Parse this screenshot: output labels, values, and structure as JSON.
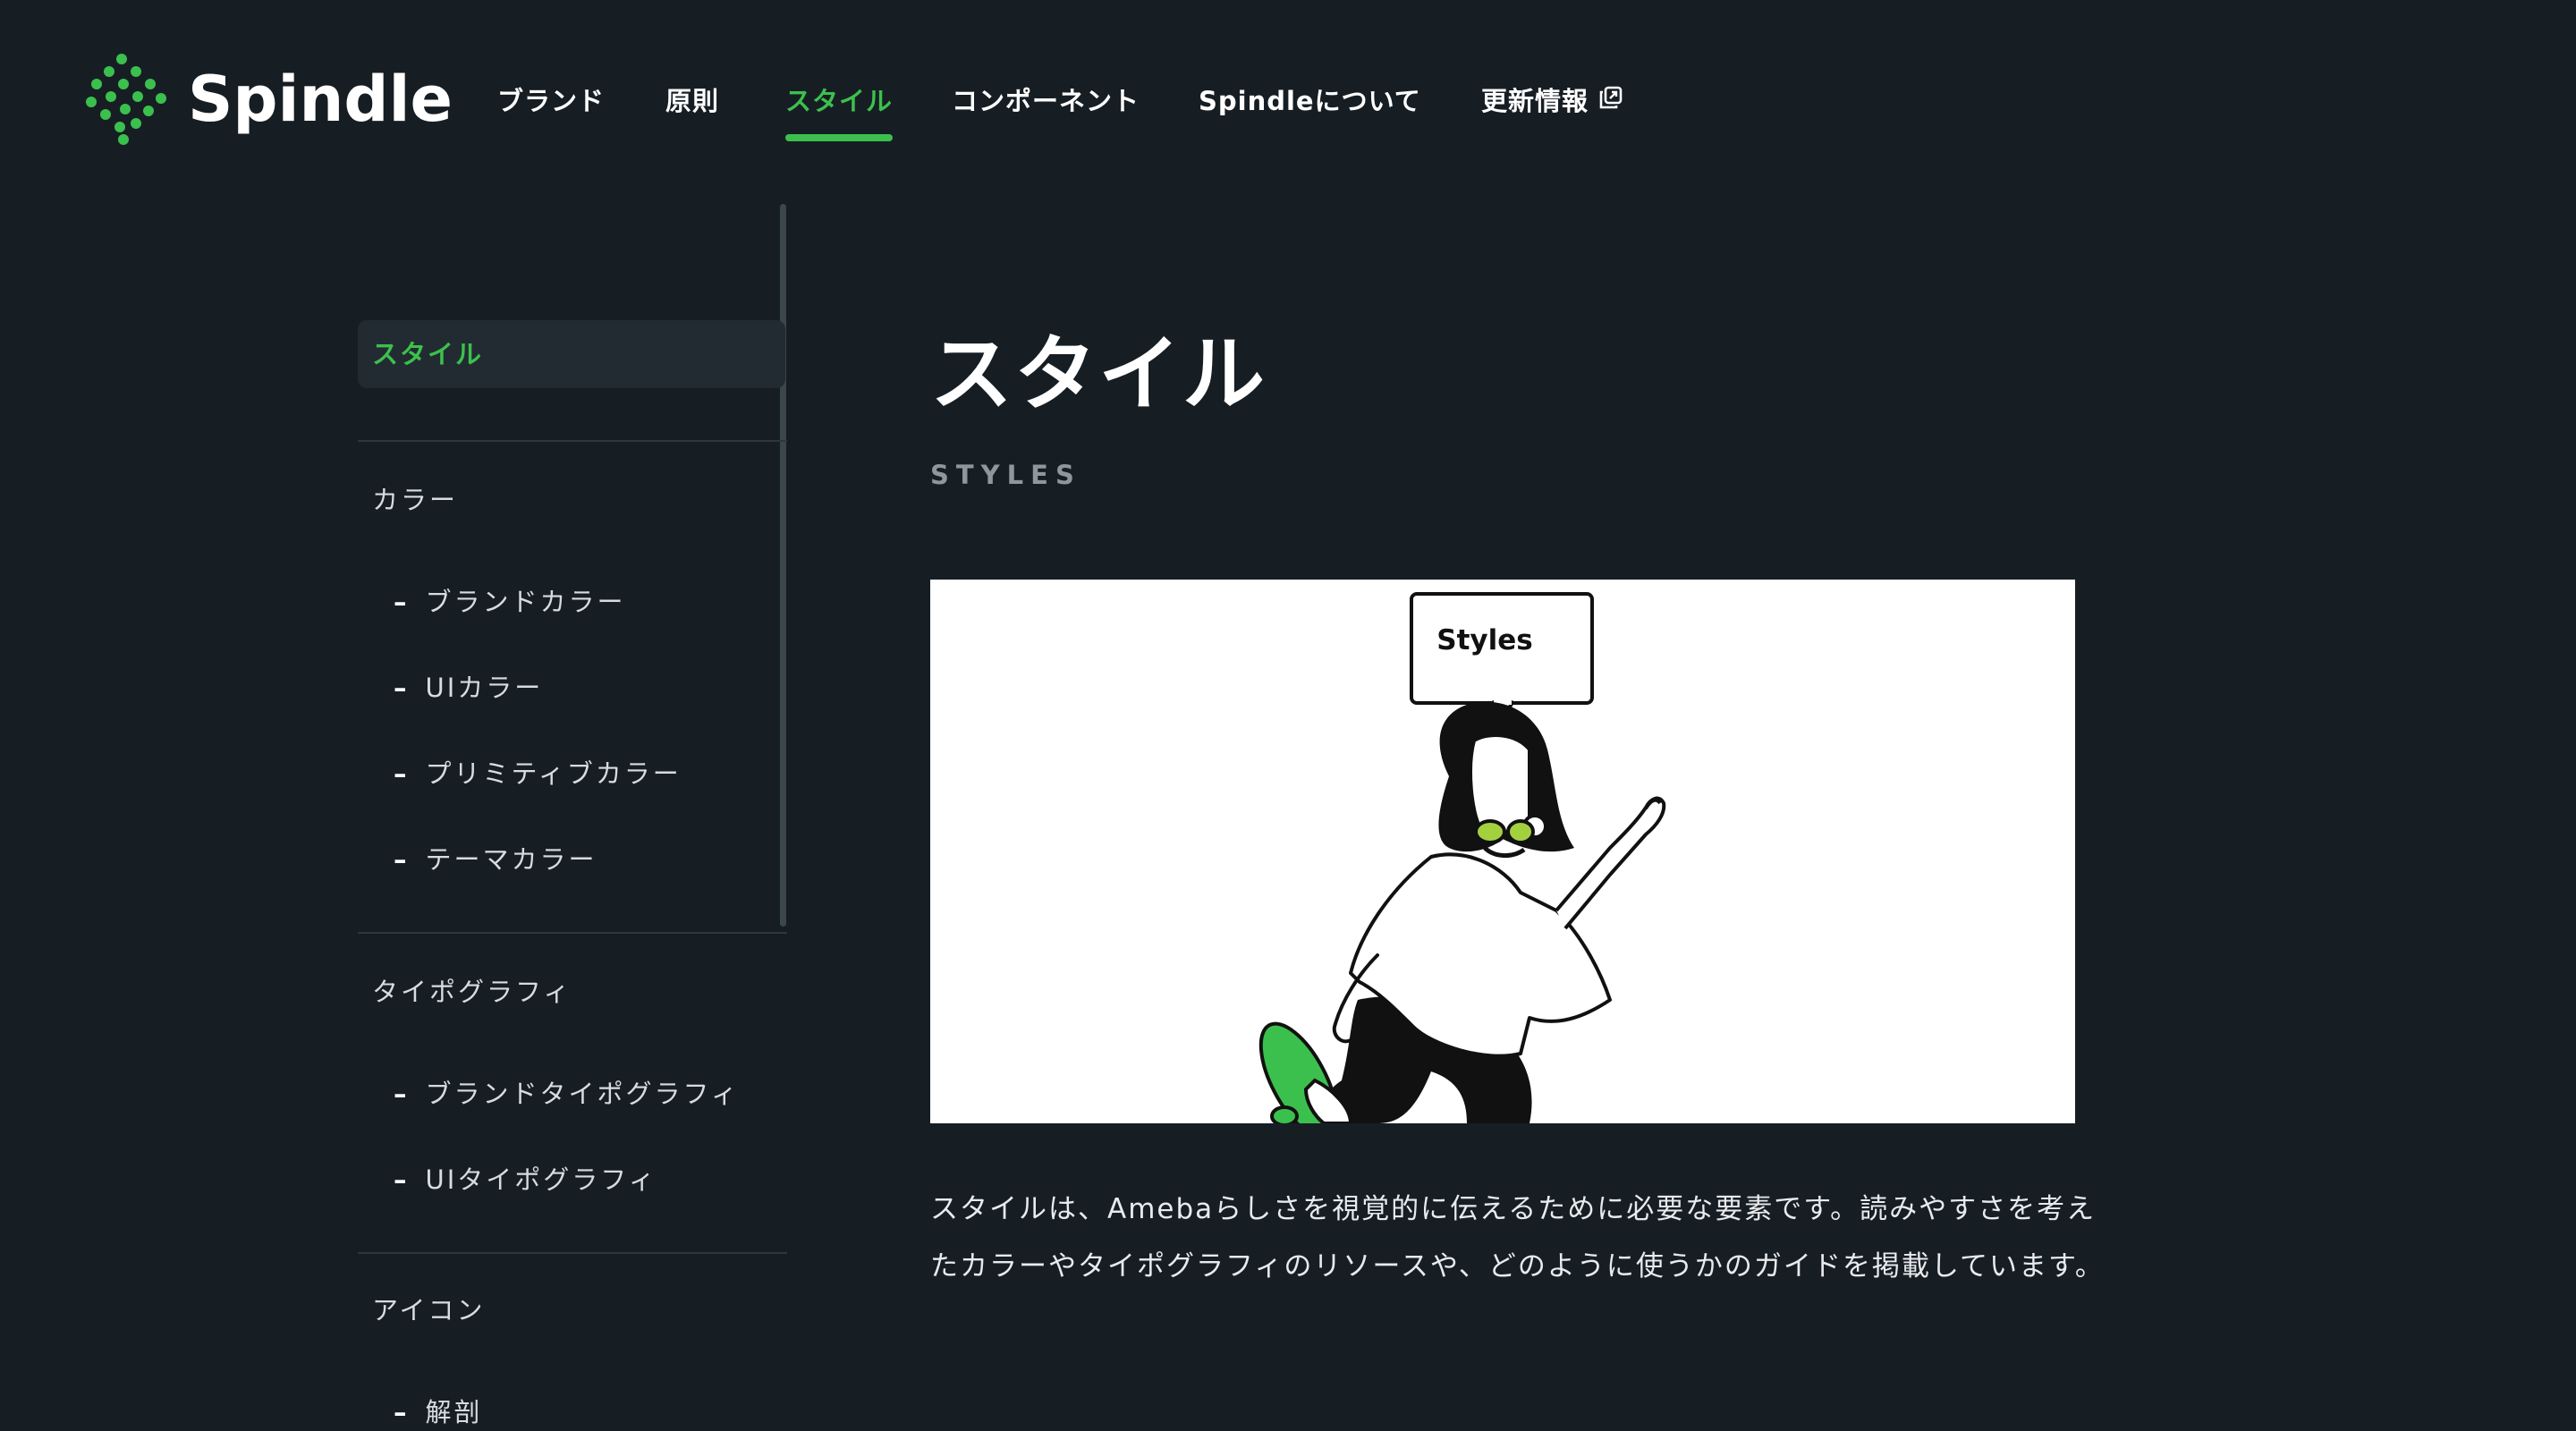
{
  "brand": {
    "name": "Spindle",
    "accent": "#3cc04d",
    "background": "#161e24"
  },
  "nav": {
    "items": [
      {
        "label": "ブランド",
        "active": false
      },
      {
        "label": "原則",
        "active": false
      },
      {
        "label": "スタイル",
        "active": true
      },
      {
        "label": "コンポーネント",
        "active": false
      },
      {
        "label": "Spindleについて",
        "active": false
      },
      {
        "label": "更新情報",
        "active": false,
        "icon": "external-link-icon"
      }
    ]
  },
  "sidebar": {
    "active_label": "スタイル",
    "sections": [
      {
        "label": "カラー",
        "items": [
          "ブランドカラー",
          "UIカラー",
          "プリミティブカラー",
          "テーマカラー"
        ]
      },
      {
        "label": "タイポグラフィ",
        "items": [
          "ブランドタイポグラフィ",
          "UIタイポグラフィ"
        ]
      },
      {
        "label": "アイコン",
        "items": [
          "解剖"
        ]
      }
    ],
    "dash": "–"
  },
  "main": {
    "title": "スタイル",
    "subtitle": "STYLES",
    "hero_bubble": "Styles",
    "description_lines": [
      "スタイルは、Amebaらしさを視覚的に伝えるために必要な要素です。読みやすさを考え",
      "たカラーやタイポグラフィのリソースや、どのように使うかのガイドを掲載しています。"
    ]
  }
}
